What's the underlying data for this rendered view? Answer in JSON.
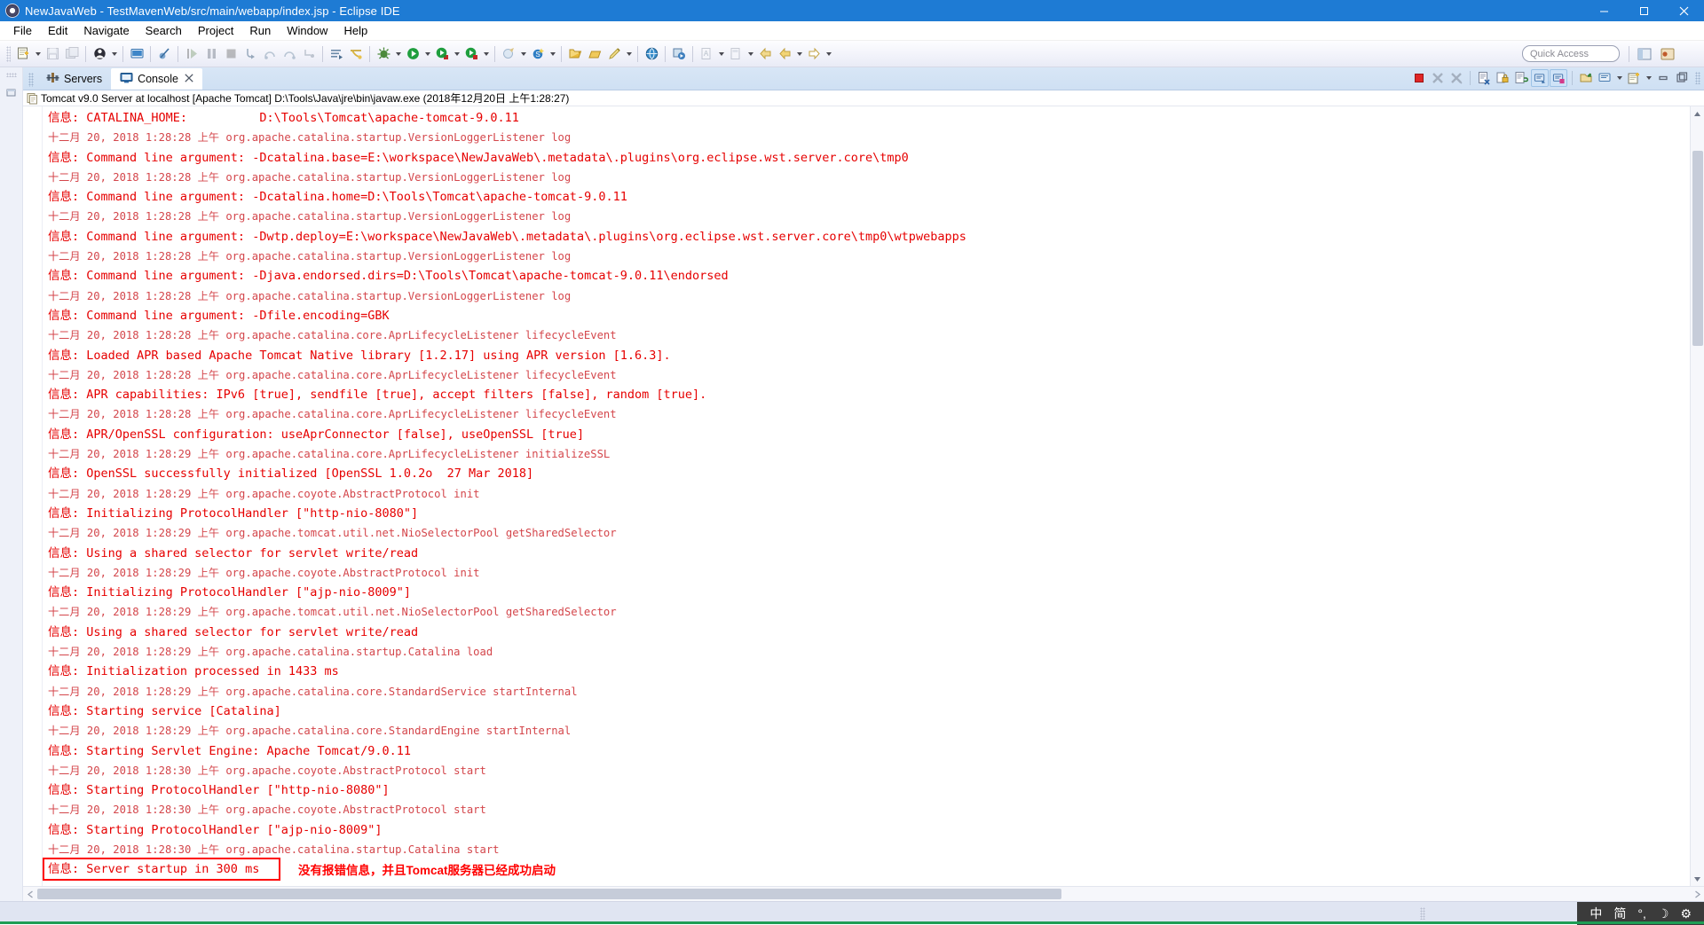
{
  "window": {
    "title": "NewJavaWeb - TestMavenWeb/src/main/webapp/index.jsp - Eclipse IDE",
    "app_icon": "eclipse-icon",
    "minimize": "minimize-icon",
    "maximize": "maximize-icon",
    "close": "close-icon"
  },
  "menubar": {
    "items": [
      {
        "label": "File"
      },
      {
        "label": "Edit"
      },
      {
        "label": "Navigate"
      },
      {
        "label": "Search"
      },
      {
        "label": "Project"
      },
      {
        "label": "Run"
      },
      {
        "label": "Window"
      },
      {
        "label": "Help"
      }
    ]
  },
  "toolbar": {
    "quick_access_placeholder": "Quick Access",
    "quick_access_value": "Quick Access",
    "buttons": [
      "new-wizard-icon",
      "save-icon",
      "save-all-icon",
      "debug-perspective-icon",
      "new-java-project-icon",
      "skip-breakpoints-icon",
      "resume-icon",
      "suspend-icon",
      "terminate-icon",
      "step-into-icon",
      "step-over-icon",
      "step-return-icon",
      "drop-to-frame-icon",
      "next-annotation-icon",
      "previous-annotation-icon",
      "debug-run-icon",
      "run-icon",
      "run-as-icon",
      "coverage-icon",
      "external-tools-icon",
      "search-icon",
      "open-type-icon",
      "open-task-icon",
      "new-folder-icon",
      "pencil-icon",
      "open-web-browser-icon",
      "profile-icon",
      "new-class-icon",
      "new-package-icon",
      "back-icon",
      "forward-icon",
      "next-edit-icon"
    ]
  },
  "left_rail": {
    "grip": "rail-grip",
    "restore_icon": "restore-view-icon"
  },
  "tabs": [
    {
      "label": "Servers",
      "icon": "servers-icon",
      "active": false,
      "closable": false
    },
    {
      "label": "Console",
      "icon": "console-icon",
      "active": true,
      "closable": true
    }
  ],
  "console_toolbar": {
    "buttons": [
      "terminate-icon",
      "remove-launch-icon",
      "remove-all-terminated-icon",
      "clear-console-icon",
      "scroll-lock-icon",
      "word-wrap-icon",
      "show-console-on-output-icon",
      "show-console-on-error-icon",
      "pin-console-icon",
      "display-selected-console-icon",
      "open-console-icon",
      "minimize-icon",
      "maximize-icon"
    ]
  },
  "console": {
    "header": "Tomcat v9.0 Server at localhost [Apache Tomcat] D:\\Tools\\Java\\jre\\bin\\javaw.exe (2018年12月20日 上午1:28:27)",
    "header_icon": "console-launch-icon",
    "lines": [
      {
        "type": "msg",
        "text": "信息: CATALINA_HOME:          D:\\Tools\\Tomcat\\apache-tomcat-9.0.11"
      },
      {
        "type": "stamp",
        "text": "十二月 20, 2018 1:28:28 上午 org.apache.catalina.startup.VersionLoggerListener log"
      },
      {
        "type": "msg",
        "text": "信息: Command line argument: -Dcatalina.base=E:\\workspace\\NewJavaWeb\\.metadata\\.plugins\\org.eclipse.wst.server.core\\tmp0"
      },
      {
        "type": "stamp",
        "text": "十二月 20, 2018 1:28:28 上午 org.apache.catalina.startup.VersionLoggerListener log"
      },
      {
        "type": "msg",
        "text": "信息: Command line argument: -Dcatalina.home=D:\\Tools\\Tomcat\\apache-tomcat-9.0.11"
      },
      {
        "type": "stamp",
        "text": "十二月 20, 2018 1:28:28 上午 org.apache.catalina.startup.VersionLoggerListener log"
      },
      {
        "type": "msg",
        "text": "信息: Command line argument: -Dwtp.deploy=E:\\workspace\\NewJavaWeb\\.metadata\\.plugins\\org.eclipse.wst.server.core\\tmp0\\wtpwebapps"
      },
      {
        "type": "stamp",
        "text": "十二月 20, 2018 1:28:28 上午 org.apache.catalina.startup.VersionLoggerListener log"
      },
      {
        "type": "msg",
        "text": "信息: Command line argument: -Djava.endorsed.dirs=D:\\Tools\\Tomcat\\apache-tomcat-9.0.11\\endorsed"
      },
      {
        "type": "stamp",
        "text": "十二月 20, 2018 1:28:28 上午 org.apache.catalina.startup.VersionLoggerListener log"
      },
      {
        "type": "msg",
        "text": "信息: Command line argument: -Dfile.encoding=GBK"
      },
      {
        "type": "stamp",
        "text": "十二月 20, 2018 1:28:28 上午 org.apache.catalina.core.AprLifecycleListener lifecycleEvent"
      },
      {
        "type": "msg",
        "text": "信息: Loaded APR based Apache Tomcat Native library [1.2.17] using APR version [1.6.3]."
      },
      {
        "type": "stamp",
        "text": "十二月 20, 2018 1:28:28 上午 org.apache.catalina.core.AprLifecycleListener lifecycleEvent"
      },
      {
        "type": "msg",
        "text": "信息: APR capabilities: IPv6 [true], sendfile [true], accept filters [false], random [true]."
      },
      {
        "type": "stamp",
        "text": "十二月 20, 2018 1:28:28 上午 org.apache.catalina.core.AprLifecycleListener lifecycleEvent"
      },
      {
        "type": "msg",
        "text": "信息: APR/OpenSSL configuration: useAprConnector [false], useOpenSSL [true]"
      },
      {
        "type": "stamp",
        "text": "十二月 20, 2018 1:28:29 上午 org.apache.catalina.core.AprLifecycleListener initializeSSL"
      },
      {
        "type": "msg",
        "text": "信息: OpenSSL successfully initialized [OpenSSL 1.0.2o  27 Mar 2018]"
      },
      {
        "type": "stamp",
        "text": "十二月 20, 2018 1:28:29 上午 org.apache.coyote.AbstractProtocol init"
      },
      {
        "type": "msg",
        "text": "信息: Initializing ProtocolHandler [\"http-nio-8080\"]"
      },
      {
        "type": "stamp",
        "text": "十二月 20, 2018 1:28:29 上午 org.apache.tomcat.util.net.NioSelectorPool getSharedSelector"
      },
      {
        "type": "msg",
        "text": "信息: Using a shared selector for servlet write/read"
      },
      {
        "type": "stamp",
        "text": "十二月 20, 2018 1:28:29 上午 org.apache.coyote.AbstractProtocol init"
      },
      {
        "type": "msg",
        "text": "信息: Initializing ProtocolHandler [\"ajp-nio-8009\"]"
      },
      {
        "type": "stamp",
        "text": "十二月 20, 2018 1:28:29 上午 org.apache.tomcat.util.net.NioSelectorPool getSharedSelector"
      },
      {
        "type": "msg",
        "text": "信息: Using a shared selector for servlet write/read"
      },
      {
        "type": "stamp",
        "text": "十二月 20, 2018 1:28:29 上午 org.apache.catalina.startup.Catalina load"
      },
      {
        "type": "msg",
        "text": "信息: Initialization processed in 1433 ms"
      },
      {
        "type": "stamp",
        "text": "十二月 20, 2018 1:28:29 上午 org.apache.catalina.core.StandardService startInternal"
      },
      {
        "type": "msg",
        "text": "信息: Starting service [Catalina]"
      },
      {
        "type": "stamp",
        "text": "十二月 20, 2018 1:28:29 上午 org.apache.catalina.core.StandardEngine startInternal"
      },
      {
        "type": "msg",
        "text": "信息: Starting Servlet Engine: Apache Tomcat/9.0.11"
      },
      {
        "type": "stamp",
        "text": "十二月 20, 2018 1:28:30 上午 org.apache.coyote.AbstractProtocol start"
      },
      {
        "type": "msg",
        "text": "信息: Starting ProtocolHandler [\"http-nio-8080\"]"
      },
      {
        "type": "stamp",
        "text": "十二月 20, 2018 1:28:30 上午 org.apache.coyote.AbstractProtocol start"
      },
      {
        "type": "msg",
        "text": "信息: Starting ProtocolHandler [\"ajp-nio-8009\"]"
      },
      {
        "type": "stamp",
        "text": "十二月 20, 2018 1:28:30 上午 org.apache.catalina.startup.Catalina start"
      },
      {
        "type": "msg",
        "text": "信息: Server startup in 300 ms",
        "highlighted": true
      }
    ],
    "annotation": "没有报错信息，并且Tomcat服务器已经成功启动",
    "annotation_color": "#ff0000",
    "highlight_color": "#ff0000"
  },
  "scrollbars": {
    "vertical_up": "scroll-up-arrow",
    "vertical_down": "scroll-down-arrow",
    "horizontal_left": "scroll-left-arrow",
    "horizontal_right": "scroll-right-arrow"
  },
  "statusbar": {
    "tray": [
      {
        "label": "中",
        "name": "ime-chinese-indicator"
      },
      {
        "label": "简",
        "name": "ime-simplified-indicator"
      },
      {
        "label": "°,",
        "name": "ime-punctuation-indicator"
      },
      {
        "label": "☽",
        "name": "ime-mode-icon"
      },
      {
        "label": "⚙",
        "name": "ime-settings-icon"
      }
    ]
  },
  "colors": {
    "title_bar": "#1e7bd4",
    "console_text": "#e60000",
    "timestamp_text": "#d4464b",
    "highlight": "#ff0000",
    "accent_green": "#1f9d55"
  }
}
